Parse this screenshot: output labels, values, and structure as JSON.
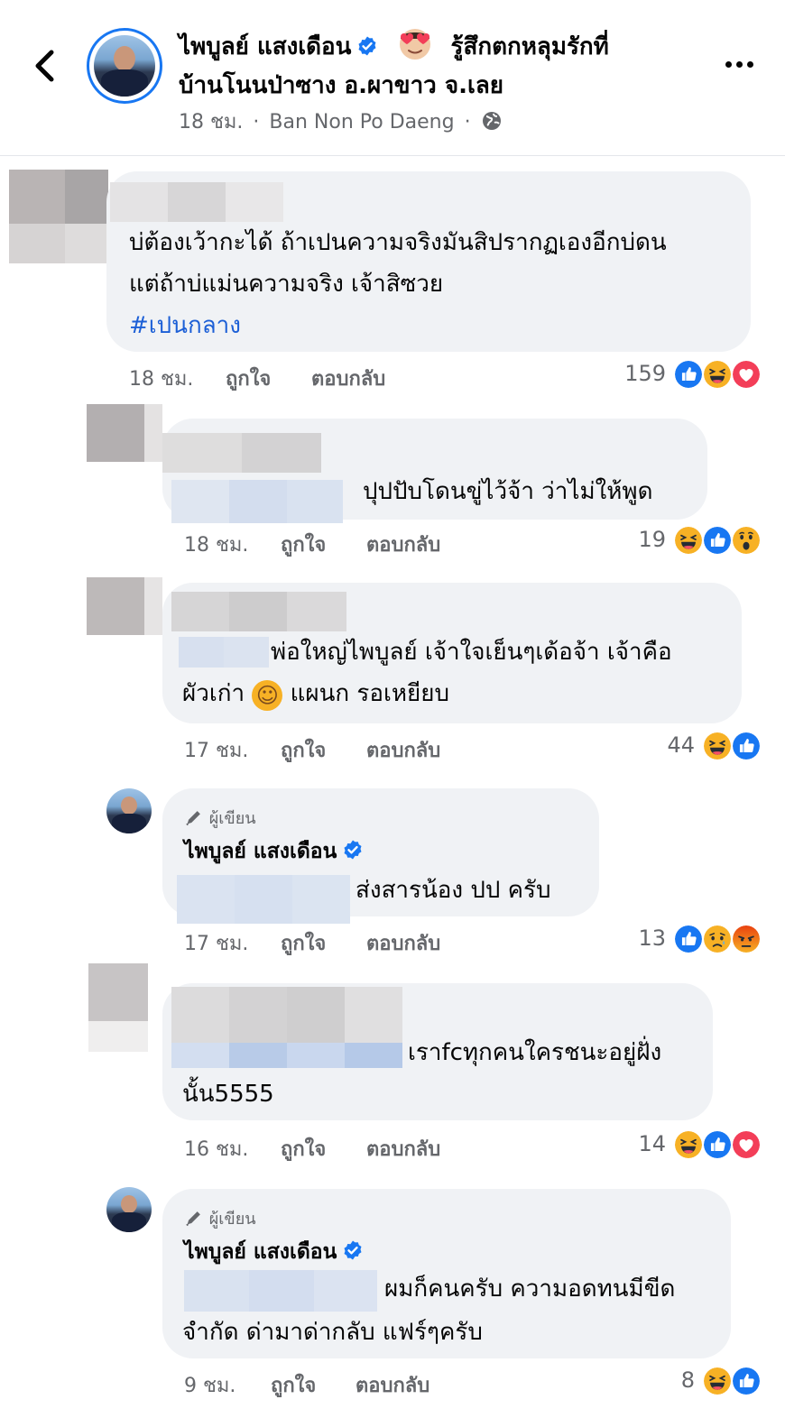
{
  "header": {
    "title_line1": "ไพบูลย์ แสงเดือน",
    "feeling_text": "รู้สึกตกหลุมรักที่",
    "title_line2": "บ้านโนนป่าซาง อ.ผาขาว จ.เลย",
    "time": "18 ชม.",
    "separator": "·",
    "location": "Ban Non Po Daeng",
    "privacy_icon": "globe-icon",
    "back_icon": "chevron-left-icon",
    "more_icon": "more-horizontal-icon",
    "feeling_icon": "heart-eyes-emoji"
  },
  "labels": {
    "like": "ถูกใจ",
    "reply": "ตอบกลับ",
    "author_tag": "ผู้เขียน"
  },
  "colors": {
    "accent": "#1877f2",
    "bubble": "#f0f2f5",
    "secondary_text": "#65676b",
    "hashtag": "#1c5fd6"
  },
  "comments": [
    {
      "line1": "บ่ต้องเว้ากะได้ ถ้าเปนความจริงมันสิปรากฏเองอีกบ่ดน",
      "line2": "แต่ถ้าบ่แม่นความจริง เจ้าสิซวย",
      "hashtag": "#เปนกลาง",
      "time": "18 ชม.",
      "reaction_count": "159",
      "reactions": [
        "like",
        "haha",
        "love"
      ]
    },
    {
      "line1": "ปุปปับโดนขู่ไว้จ้า ว่าไม่ให้พูด",
      "time": "18 ชม.",
      "reaction_count": "19",
      "reactions": [
        "haha",
        "like",
        "wow"
      ]
    },
    {
      "line1": "พ่อใหญ่ไพบูลย์ เจ้าใจเย็นๆเด้อจ้า เจ้าคือ",
      "line2_a": "ผัวเก่า",
      "line2_emoji": "☺",
      "line2_b": " แผนก รอเหยียบ",
      "time": "17 ชม.",
      "reaction_count": "44",
      "reactions": [
        "haha",
        "like"
      ]
    },
    {
      "author": "ไพบูลย์ แสงเดือน",
      "line1": "ส่งสารน้อง ปป ครับ",
      "time": "17 ชม.",
      "reaction_count": "13",
      "reactions": [
        "like",
        "sad",
        "angry"
      ]
    },
    {
      "line1": "เราfcทุกคนใครชนะอยู่ฝั่ง",
      "line2": "นั้น5555",
      "time": "16 ชม.",
      "reaction_count": "14",
      "reactions": [
        "haha",
        "like",
        "love"
      ]
    },
    {
      "author": "ไพบูลย์ แสงเดือน",
      "line1": "ผมก็คนครับ ความอดทนมีขีด",
      "line2": "จำกัด ด่ามาด่ากลับ แฟร์ๆครับ",
      "time": "9 ชม.",
      "reaction_count": "8",
      "reactions": [
        "haha",
        "like"
      ]
    }
  ]
}
